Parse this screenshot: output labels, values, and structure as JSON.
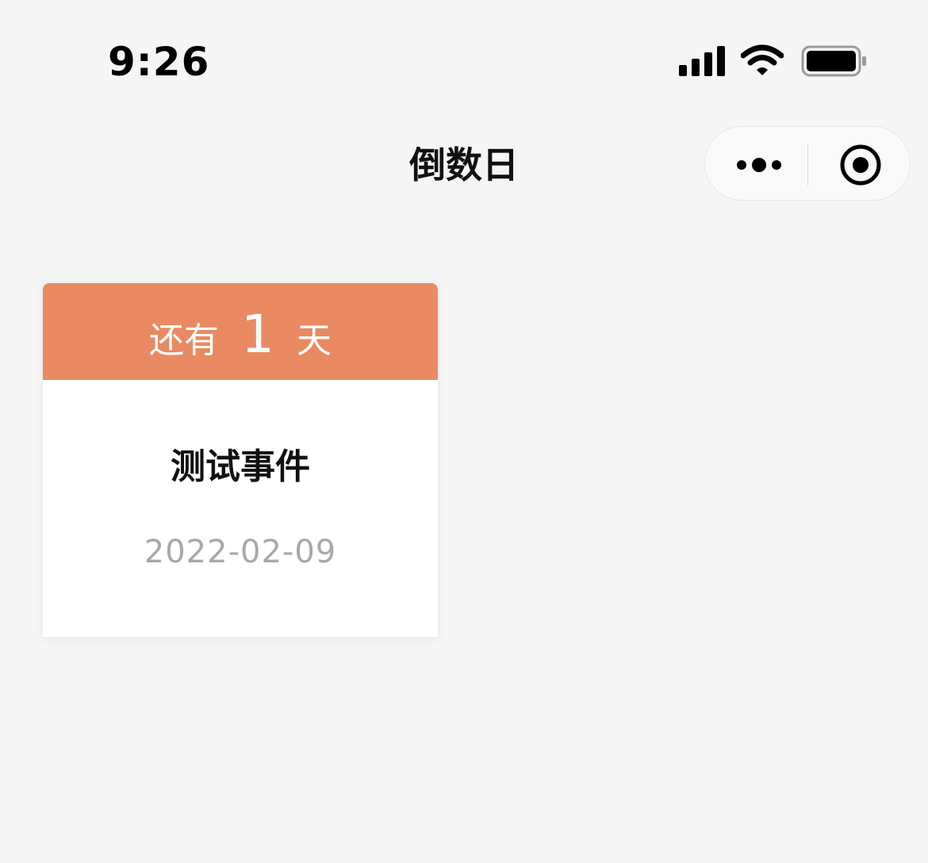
{
  "status_bar": {
    "time": "9:26",
    "icons": [
      "signal-icon",
      "wifi-icon",
      "battery-icon"
    ]
  },
  "nav": {
    "title": "倒数日",
    "capsule_icons": [
      "more-icon",
      "close-target-icon"
    ]
  },
  "card": {
    "header_color": "#e98a62",
    "countdown_prefix": "还有",
    "countdown_number": "1",
    "countdown_suffix": "天",
    "event_name": "测试事件",
    "event_date": "2022-02-09"
  }
}
